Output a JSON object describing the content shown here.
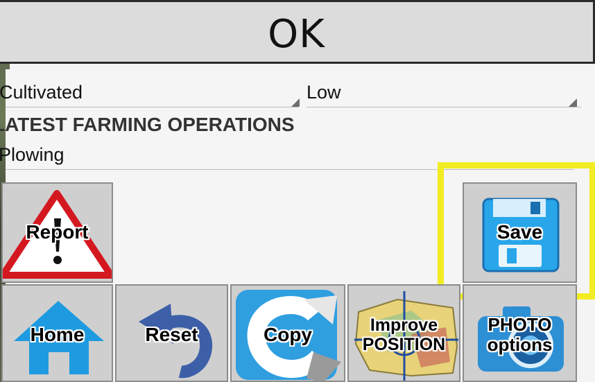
{
  "ok_button": {
    "label": "OK"
  },
  "form": {
    "field1_value": "Cultivated",
    "field2_value": "Low",
    "section_title": "LATEST FARMING OPERATIONS",
    "operation_value": "Plowing"
  },
  "buttons": {
    "report": "Report",
    "save": "Save",
    "home": "Home",
    "reset": "Reset",
    "copy": "Copy",
    "improve_line1": "Improve",
    "improve_line2": "POSITION",
    "photo_line1": "PHOTO",
    "photo_line2": "options"
  },
  "icons": {
    "report": "warning-triangle-icon",
    "save": "floppy-disk-icon",
    "home": "house-icon",
    "reset": "undo-arrow-icon",
    "copy": "copy-c-icon",
    "improve": "map-crosshair-icon",
    "photo": "camera-icon"
  },
  "colors": {
    "highlight": "#f2ec22",
    "tile_bg": "#cfcfcf"
  }
}
